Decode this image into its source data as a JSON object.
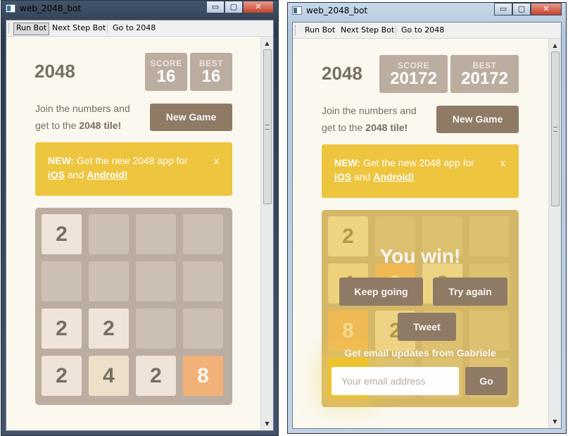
{
  "window_title": "web_2048_bot",
  "window_controls": {
    "minimize": "▭",
    "maximize": "▢",
    "close": "✕"
  },
  "toolbar": {
    "run_bot": "Run Bot",
    "next_step_bot": "Next Step Bot",
    "go_to_2048": "Go to 2048"
  },
  "game_title": "2048",
  "score_label": "SCORE",
  "best_label": "BEST",
  "intro_line1": "Join the numbers and",
  "intro_line2_prefix": "get to the ",
  "intro_line2_bold": "2048 tile!",
  "new_game_label": "New Game",
  "banner": {
    "new": "NEW:",
    "text": " Get the new 2048 app for",
    "ios": "iOS",
    "and": " and ",
    "android": "Android!",
    "close": "x"
  },
  "left": {
    "score": "16",
    "best": "16",
    "tiles": [
      {
        "value": "2",
        "row": 0,
        "col": 0
      },
      {
        "value": "2",
        "row": 2,
        "col": 0
      },
      {
        "value": "2",
        "row": 2,
        "col": 1
      },
      {
        "value": "2",
        "row": 3,
        "col": 0
      },
      {
        "value": "4",
        "row": 3,
        "col": 1
      },
      {
        "value": "2",
        "row": 3,
        "col": 2
      },
      {
        "value": "8",
        "row": 3,
        "col": 3
      }
    ]
  },
  "right": {
    "score": "20172",
    "best": "20172",
    "tiles": [
      {
        "value": "2",
        "row": 0,
        "col": 0
      },
      {
        "value": "4",
        "row": 1,
        "col": 0
      },
      {
        "value": "8",
        "row": 1,
        "col": 1
      },
      {
        "value": "2",
        "row": 1,
        "col": 2
      },
      {
        "value": "8",
        "row": 2,
        "col": 0
      },
      {
        "value": "2",
        "row": 2,
        "col": 1
      }
    ],
    "overlay": {
      "message": "You win!",
      "keep_going": "Keep going",
      "try_again": "Try again",
      "tweet": "Tweet",
      "email_prompt": "Get email updates from Gabriele",
      "email_placeholder": "Your email address",
      "go": "Go"
    }
  },
  "colors": {
    "board": "#bbada0",
    "tile2": "#eee4da",
    "tile4": "#ede0c8",
    "tile8": "#f2b179",
    "button": "#8f7a66",
    "banner": "#edc53f",
    "page": "#faf8ef"
  }
}
